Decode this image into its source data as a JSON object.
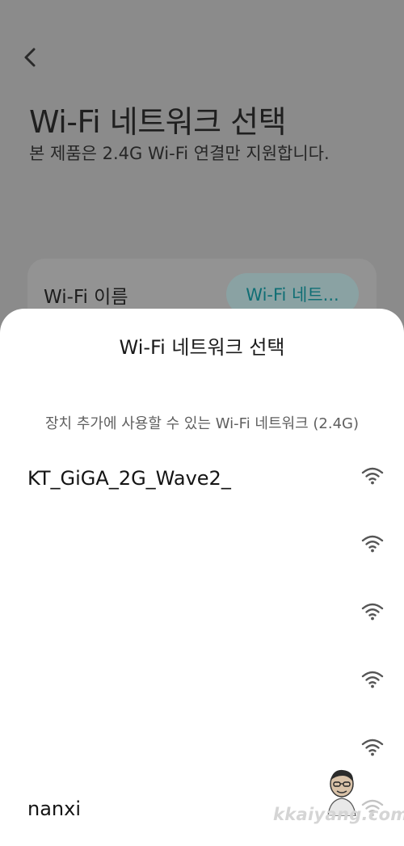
{
  "background_screen": {
    "page_title": "Wi-Fi 네트워크 선택",
    "page_subtitle": "본 제품은 2.4G Wi-Fi 연결만 지원합니다.",
    "card": {
      "label": "Wi-Fi 이름",
      "button_label": "Wi-Fi 네트..."
    }
  },
  "sheet": {
    "title": "Wi-Fi 네트워크 선택",
    "caption": "장치 추가에 사용할 수 있는 Wi-Fi 네트워크 (2.4G)",
    "networks": [
      {
        "name": "KT_GiGA_2G_Wave2_"
      },
      {
        "name": ""
      },
      {
        "name": ""
      },
      {
        "name": ""
      },
      {
        "name": ""
      },
      {
        "name": "nanxi"
      }
    ]
  },
  "watermark": {
    "text": "kkaiyang.com"
  },
  "icons": {
    "back": "chevron-left-icon",
    "wifi": "wifi-signal-icon",
    "avatar": "person-avatar-icon"
  },
  "colors": {
    "dim_overlay": "#8b8b8b",
    "accent_teal": "#0f6e74",
    "sheet_bg": "#ffffff"
  }
}
